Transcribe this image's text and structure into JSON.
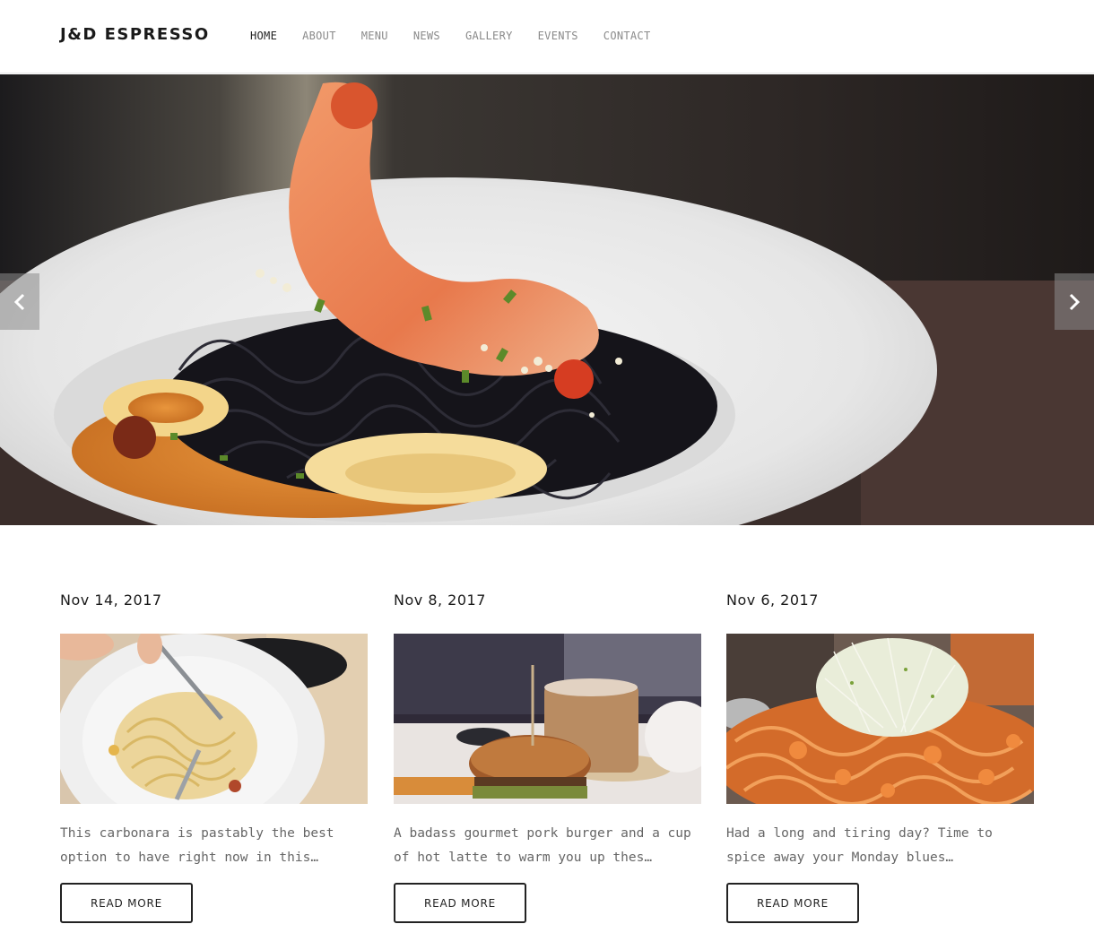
{
  "brand": {
    "name": "J&D ESPRESSO"
  },
  "nav": {
    "items": [
      {
        "label": "HOME",
        "active": true
      },
      {
        "label": "ABOUT",
        "active": false
      },
      {
        "label": "MENU",
        "active": false
      },
      {
        "label": "NEWS",
        "active": false
      },
      {
        "label": "GALLERY",
        "active": false
      },
      {
        "label": "EVENTS",
        "active": false
      },
      {
        "label": "CONTACT",
        "active": false
      }
    ]
  },
  "hero": {
    "image": "black squid-ink pasta with shrimp and squid rings on a white plate",
    "prev_icon": "chevron-left-icon",
    "next_icon": "chevron-right-icon"
  },
  "news": {
    "posts": [
      {
        "date": "Nov 14, 2017",
        "image": "carbonara spaghetti in a white bowl",
        "excerpt": "This carbonara is pastably the best option to have right now in this…",
        "button": "READ MORE"
      },
      {
        "date": "Nov 8, 2017",
        "image": "pork burger with fries and a cup of latte",
        "excerpt": "A badass gourmet pork burger and a cup of hot latte to warm you up thes…",
        "button": "READ MORE"
      },
      {
        "date": "Nov 6, 2017",
        "image": "spicy stir-fried noodles with shrimp and sprouts",
        "excerpt": "Had a long and tiring day? Time to spice away your Monday blues…",
        "button": "READ MORE"
      }
    ]
  },
  "colors": {
    "text_dark": "#1a1a1a",
    "nav_muted": "#8a8a8a",
    "excerpt": "#666666",
    "button_border": "#222222"
  }
}
